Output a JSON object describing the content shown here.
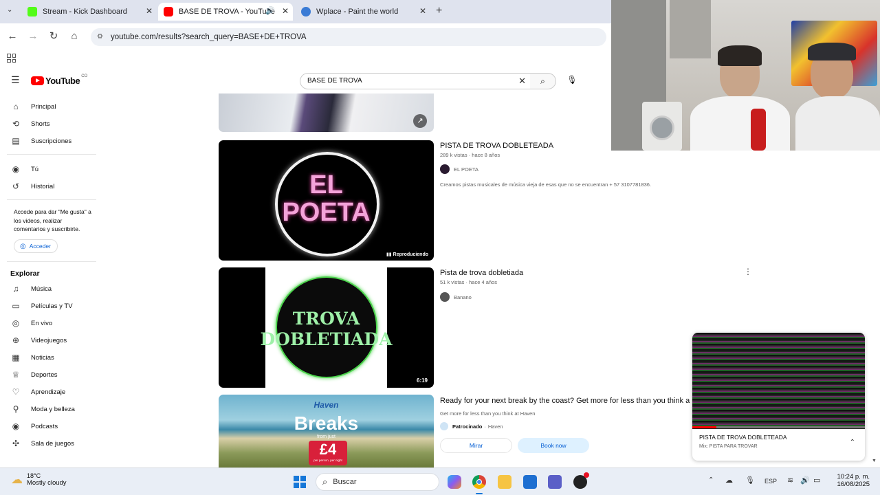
{
  "browser": {
    "tabs": [
      {
        "title": "Stream - Kick Dashboard",
        "active": false
      },
      {
        "title": "BASE DE TROVA - YouTube",
        "active": true
      },
      {
        "title": "Wplace - Paint the world",
        "active": false
      }
    ],
    "url": "youtube.com/results?search_query=BASE+DE+TROVA"
  },
  "youtube": {
    "logo_text": "YouTube",
    "logo_region": "CO",
    "search_value": "BASE DE TROVA",
    "sidebar": {
      "main": [
        {
          "label": "Principal",
          "icon": "home-icon"
        },
        {
          "label": "Shorts",
          "icon": "shorts-icon"
        },
        {
          "label": "Suscripciones",
          "icon": "subscriptions-icon"
        }
      ],
      "you": [
        {
          "label": "Tú",
          "icon": "you-icon"
        },
        {
          "label": "Historial",
          "icon": "history-icon"
        }
      ],
      "signin_text": "Accede para dar \"Me gusta\" a los videos, realizar comentarios y suscribirte.",
      "signin_button": "Acceder",
      "explore_heading": "Explorar",
      "explore": [
        {
          "label": "Música",
          "icon": "music-icon"
        },
        {
          "label": "Películas y TV",
          "icon": "movies-icon"
        },
        {
          "label": "En vivo",
          "icon": "live-icon"
        },
        {
          "label": "Videojuegos",
          "icon": "gaming-icon"
        },
        {
          "label": "Noticias",
          "icon": "news-icon"
        },
        {
          "label": "Deportes",
          "icon": "sports-icon"
        },
        {
          "label": "Aprendizaje",
          "icon": "learning-icon"
        },
        {
          "label": "Moda y belleza",
          "icon": "fashion-icon"
        },
        {
          "label": "Podcasts",
          "icon": "podcast-icon"
        },
        {
          "label": "Sala de juegos",
          "icon": "playables-icon"
        }
      ]
    },
    "results": [
      {
        "title": "PISTA DE TROVA DOBLETEADA",
        "meta": "289 k vistas · hace 8 años",
        "channel": "EL POETA",
        "description": "Creamos pistas musicales de música vieja de esas que no se encuentran + 57 3107781836.",
        "thumb_text_1": "EL",
        "thumb_text_2": "POETA",
        "badge": "Reproduciendo"
      },
      {
        "title": "Pista de trova dobletiada",
        "meta": "51 k vistas · hace 4 años",
        "channel": "Banano",
        "thumb_text_1": "TROVA",
        "thumb_text_2": "DOBLETIADA",
        "duration": "6:19"
      }
    ],
    "ad": {
      "title": "Ready for your next break by the coast? Get more for less than you think a",
      "subtitle": "Get more for less than you think at Haven",
      "sponsored": "Patrocinado",
      "advertiser": "Haven",
      "thumb_brand": "Haven",
      "thumb_headline": "Breaks",
      "thumb_from": "from just",
      "thumb_price": "£4",
      "thumb_per": "per person, per night",
      "watch_button": "Mirar",
      "book_button": "Book now"
    },
    "miniplayer": {
      "title": "PISTA DE TROVA DOBLETEADA",
      "subtitle": "Mix: PISTA PARA TROVAR"
    }
  },
  "taskbar": {
    "weather_temp": "18°C",
    "weather_desc": "Mostly cloudy",
    "search_label": "Buscar",
    "language": "ESP",
    "time": "10:24 p. m.",
    "date": "16/08/2025"
  }
}
